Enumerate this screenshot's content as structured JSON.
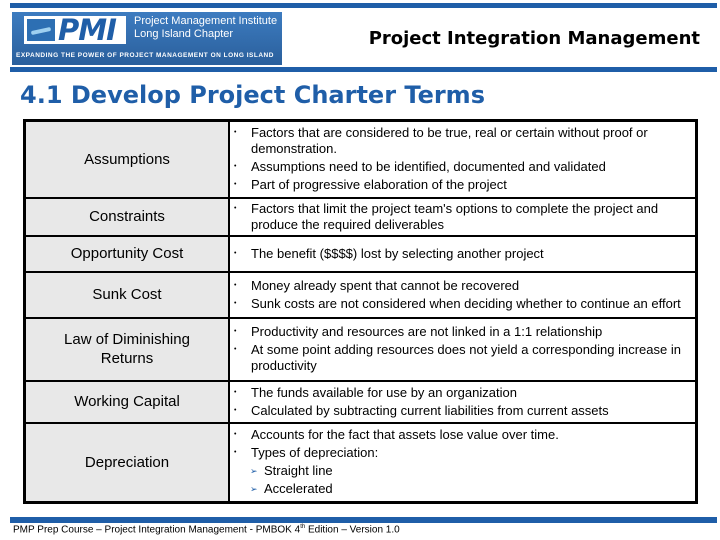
{
  "header": {
    "logo_text": "PMI",
    "org_name_line1": "Project Management Institute",
    "org_name_line2": "Long Island Chapter",
    "tagline": "EXPANDING THE POWER OF PROJECT MANAGEMENT ON LONG ISLAND",
    "section_title": "Project Integration Management",
    "accent_color": "#1f5ea8"
  },
  "page_title": "4.1 Develop Project Charter Terms",
  "terms": [
    {
      "term": "Assumptions",
      "bullets": [
        "Factors that are considered to be true, real or certain without proof or demonstration.",
        "Assumptions need to be identified, documented and validated",
        "Part of progressive elaboration of the project"
      ]
    },
    {
      "term": "Constraints",
      "bullets": [
        "Factors that limit the project team's options to complete the project and produce the required deliverables"
      ]
    },
    {
      "term": "Opportunity Cost",
      "bullets": [
        "The benefit ($$$$) lost by selecting another project"
      ]
    },
    {
      "term": "Sunk Cost",
      "bullets": [
        "Money already spent that cannot be recovered",
        "Sunk costs are not considered when deciding whether to continue an effort"
      ]
    },
    {
      "term": "Law of Diminishing Returns",
      "bullets": [
        "Productivity and resources are not linked in a 1:1 relationship",
        "At some point adding resources does not yield a corresponding increase in productivity"
      ]
    },
    {
      "term": "Working Capital",
      "bullets": [
        "The funds available for use by an organization",
        "Calculated by subtracting current liabilities from current assets"
      ]
    },
    {
      "term": "Depreciation",
      "bullets": [
        "Accounts for the fact that assets lose value over time.",
        "Types of depreciation:"
      ],
      "sub_bullets": [
        "Straight line",
        "Accelerated"
      ]
    }
  ],
  "footer": {
    "text_before": "PMP Prep Course – Project Integration Management - PMBOK 4",
    "superscript": "th",
    "text_after": " Edition – Version 1.0"
  }
}
